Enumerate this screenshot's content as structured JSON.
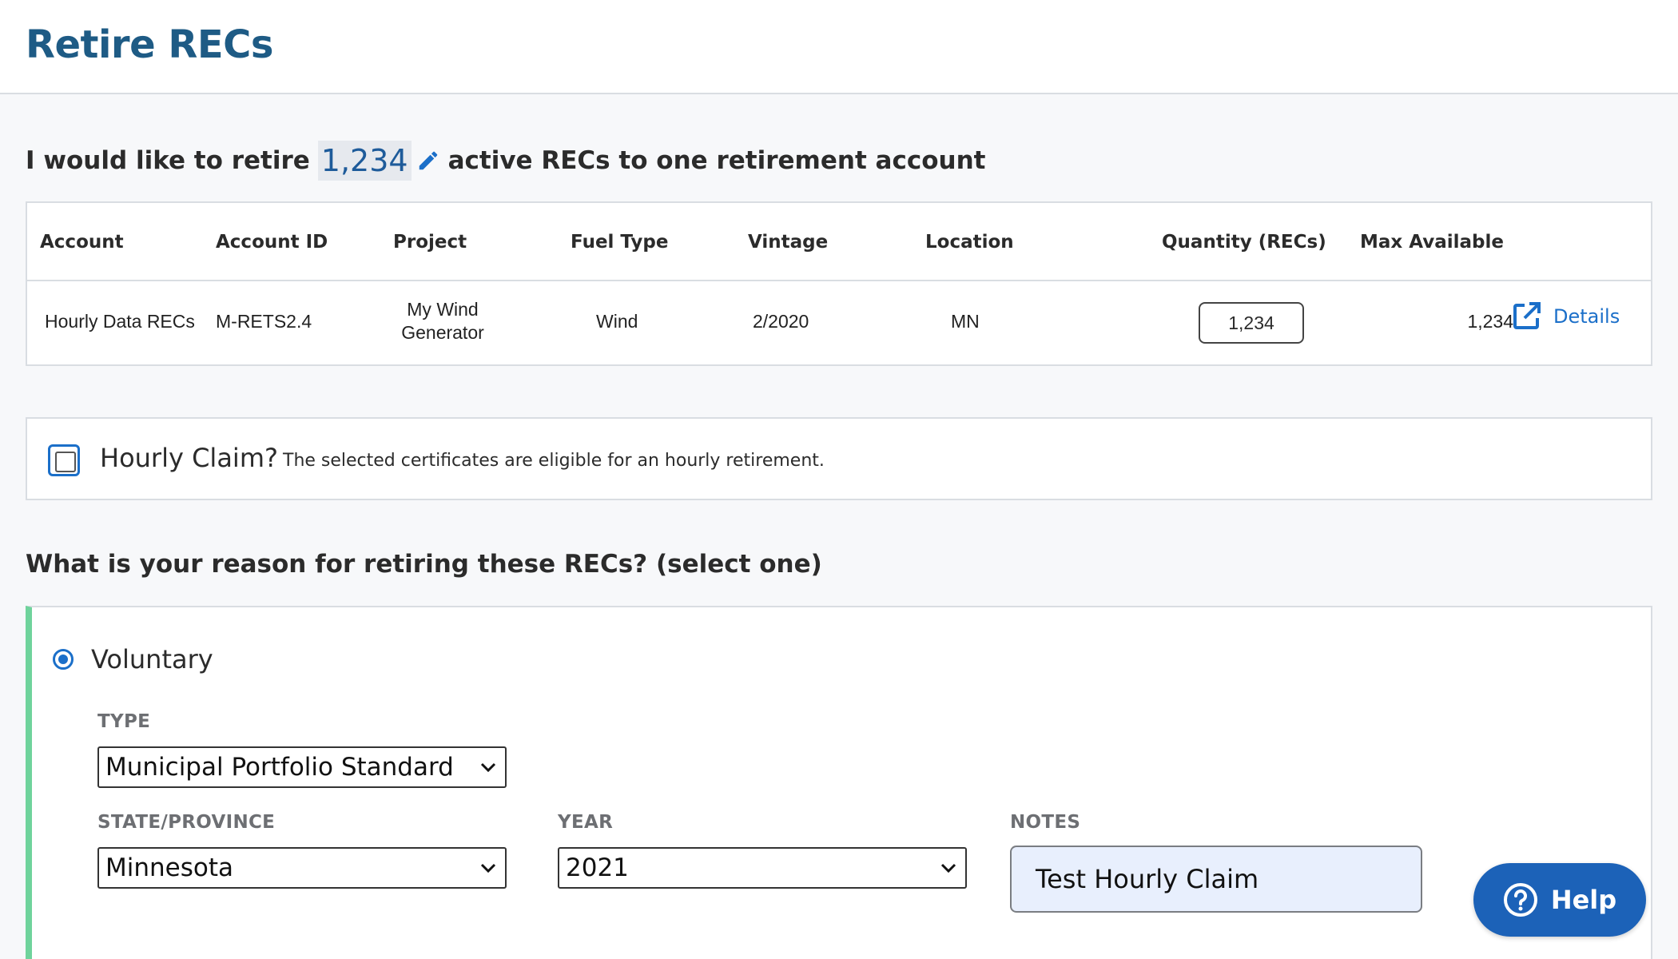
{
  "header": {
    "title": "Retire RECs"
  },
  "retire_sentence": {
    "prefix": "I would like to retire",
    "quantity": "1,234",
    "suffix": "active RECs to one retirement account"
  },
  "table": {
    "headers": [
      "Account",
      "Account ID",
      "Project",
      "Fuel Type",
      "Vintage",
      "Location",
      "Quantity (RECs)",
      "Max Available"
    ],
    "row": {
      "account": "Hourly Data RECs",
      "account_id": "M-RETS2.4",
      "project_line1": "My Wind",
      "project_line2": "Generator",
      "fuel_type": "Wind",
      "vintage": "2/2020",
      "location": "MN",
      "quantity": "1,234",
      "max_available": "1,234",
      "details_label": "Details"
    }
  },
  "hourly": {
    "label": "Hourly Claim?",
    "checked": false,
    "note": "The selected certificates are eligible for an hourly retirement."
  },
  "reason": {
    "heading": "What is your reason for retiring these RECs? (select one)",
    "option_label": "Voluntary",
    "type_label": "TYPE",
    "type_value": "Municipal Portfolio Standard",
    "state_label": "STATE/PROVINCE",
    "state_value": "Minnesota",
    "year_label": "YEAR",
    "year_value": "2021",
    "notes_label": "NOTES",
    "notes_value": "Test Hourly Claim"
  },
  "help": {
    "label": "Help"
  },
  "icons": {
    "edit": "pencil-icon",
    "details": "external-link-icon",
    "help": "question-circle-icon",
    "select": "chevron-down-icon"
  },
  "colors": {
    "title": "#1e5b85",
    "link": "#1b6fc9",
    "accent_bar": "#6fd39c",
    "help_button": "#1c62b8",
    "notes_bg": "#e8effd"
  }
}
